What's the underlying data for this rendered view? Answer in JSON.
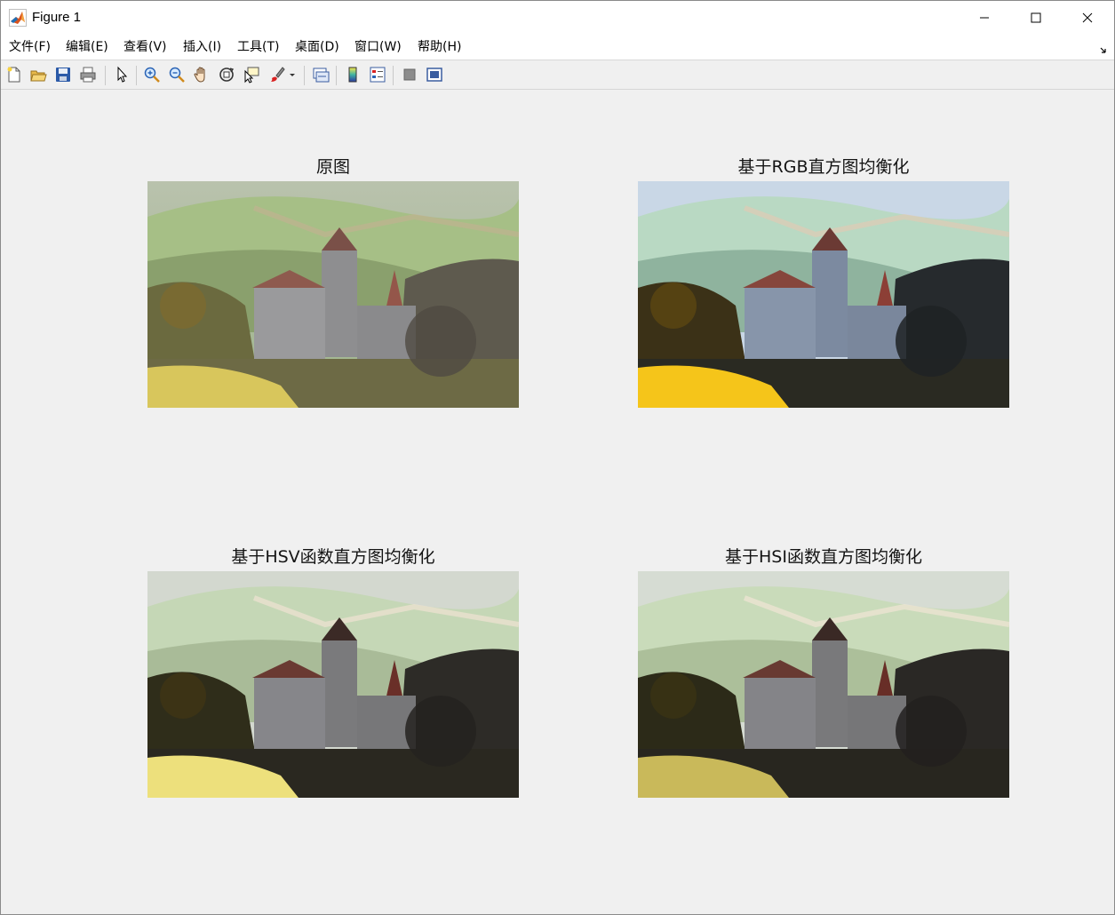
{
  "window": {
    "title": "Figure 1",
    "icon": "matlab-logo-icon"
  },
  "menu": [
    {
      "label": "文件(F)"
    },
    {
      "label": "编辑(E)"
    },
    {
      "label": "查看(V)"
    },
    {
      "label": "插入(I)"
    },
    {
      "label": "工具(T)"
    },
    {
      "label": "桌面(D)"
    },
    {
      "label": "窗口(W)"
    },
    {
      "label": "帮助(H)"
    }
  ],
  "toolbar": [
    "new-figure-icon",
    "open-file-icon",
    "save-icon",
    "print-icon",
    "select-arrow-icon",
    "zoom-in-icon",
    "zoom-out-icon",
    "pan-hand-icon",
    "rotate-3d-icon",
    "data-cursor-icon",
    "brush-icon",
    "link-plot-icon",
    "insert-colorbar-icon",
    "insert-legend-icon",
    "hide-plot-tools-icon",
    "show-plot-tools-icon"
  ],
  "subplots": [
    {
      "title": "原图",
      "variant": "original"
    },
    {
      "title": "基于RGB直方图均衡化",
      "variant": "rgb"
    },
    {
      "title": "基于HSV函数直方图均衡化",
      "variant": "hsv"
    },
    {
      "title": "基于HSI函数直方图均衡化",
      "variant": "hsi"
    }
  ],
  "colors": {
    "titlebar_bg": "#ffffff",
    "figure_bg": "#f0f0f0",
    "axes_title": "#141414"
  }
}
